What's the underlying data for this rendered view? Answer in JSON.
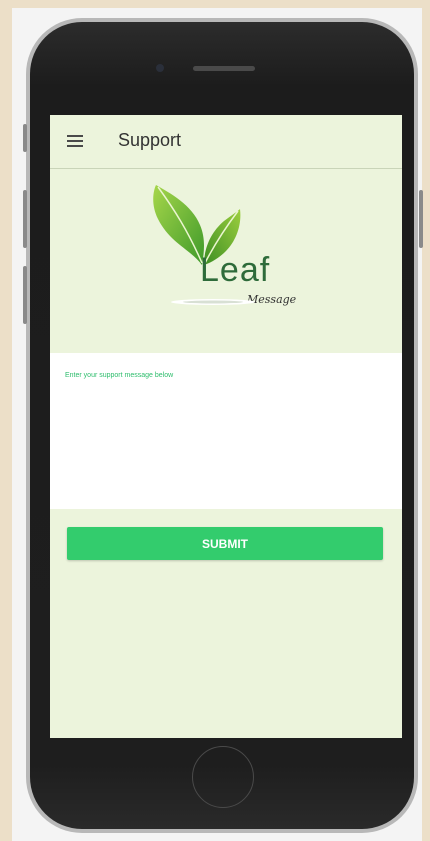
{
  "app_bar": {
    "title": "Support"
  },
  "logo": {
    "word": "Leaf",
    "sub": "Message"
  },
  "message": {
    "label": "Enter your support message below",
    "value": ""
  },
  "submit": {
    "label": "SUBMIT"
  },
  "colors": {
    "accent": "#33cc6d",
    "screen_bg": "#ecf4dc",
    "label": "#2dbd6c"
  }
}
